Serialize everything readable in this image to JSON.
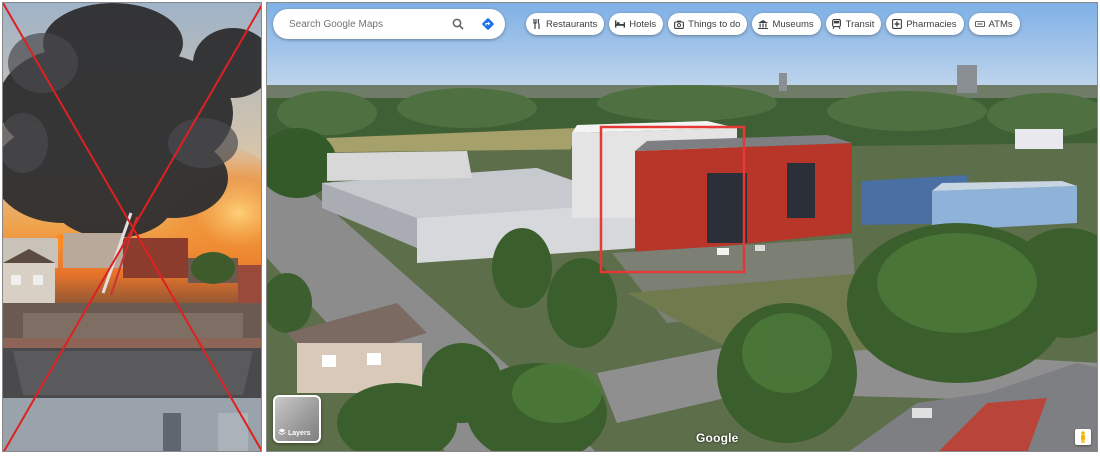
{
  "search": {
    "placeholder": "Search Google Maps"
  },
  "chips": [
    {
      "label": "Restaurants",
      "icon": "fork-knife-icon"
    },
    {
      "label": "Hotels",
      "icon": "bed-icon"
    },
    {
      "label": "Things to do",
      "icon": "camera-icon"
    },
    {
      "label": "Museums",
      "icon": "museum-icon"
    },
    {
      "label": "Transit",
      "icon": "train-icon"
    },
    {
      "label": "Pharmacies",
      "icon": "pharmacy-icon"
    },
    {
      "label": "ATMs",
      "icon": "atm-icon"
    }
  ],
  "layers": {
    "label": "Layers"
  },
  "logo": {
    "text": "Google"
  },
  "colors": {
    "highlight_box": "#e53935",
    "cross": "#e02020",
    "sky": "#8fb7e0",
    "building_brick": "#b8352a",
    "search_icon_blue": "#1a73e8"
  }
}
